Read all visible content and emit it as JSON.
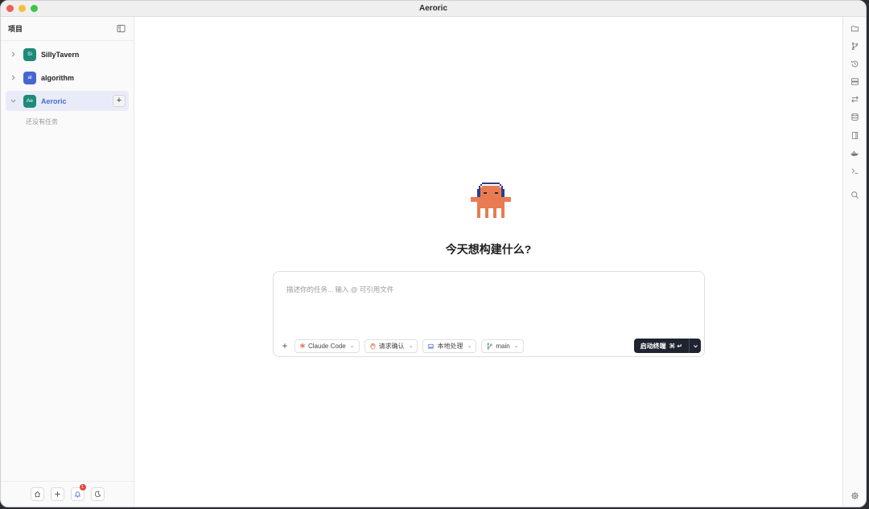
{
  "window": {
    "title": "Aeroric"
  },
  "traffic_lights": {
    "close": "#ee5f57",
    "minimize": "#f6be3b",
    "zoom": "#3fc34c"
  },
  "sidebar": {
    "header_label": "项目",
    "toggle_icon": "sidebar-panel-icon",
    "projects": [
      {
        "avatar": "Si",
        "name": "SillyTavern",
        "color": "#1e8a7a",
        "expanded": false
      },
      {
        "avatar": "al",
        "name": "algorithm",
        "color": "#4666d0",
        "expanded": false
      },
      {
        "avatar": "Ae",
        "name": "Aeroric",
        "color": "#1e8a7a",
        "expanded": true,
        "active": true
      }
    ],
    "add_task_label": "+",
    "empty_text": "还没有任务",
    "footer": {
      "notification_count": "1"
    }
  },
  "main": {
    "headline": "今天想构建什么?",
    "composer": {
      "placeholder": "描述你的任务... 输入 @ 可引用文件",
      "add_label": "+",
      "chips": [
        {
          "icon": "asterisk-icon",
          "label": "Claude Code",
          "color": "#e07a4f"
        },
        {
          "icon": "hand-icon",
          "label": "请求确认",
          "color": "#e07a4f"
        },
        {
          "icon": "laptop-icon",
          "label": "本地处理",
          "color": "#4a6bd0"
        },
        {
          "icon": "branch-icon",
          "label": "main",
          "color": "#4a8f6a"
        }
      ],
      "start_button": {
        "label": "启动终端",
        "shortcut": "⌘ ↵"
      }
    }
  },
  "rightbar": {
    "icons": [
      "folder-icon",
      "git-branch-icon",
      "history-icon",
      "server-icon",
      "diff-arrows-icon",
      "database-icon",
      "book-icon",
      "docker-icon",
      "terminal-icon",
      "search-icon",
      "settings-icon"
    ]
  },
  "colors": {
    "accent": "#4a6bd0",
    "mascot": "#e87b52",
    "headphones": "#2d3c8f"
  }
}
